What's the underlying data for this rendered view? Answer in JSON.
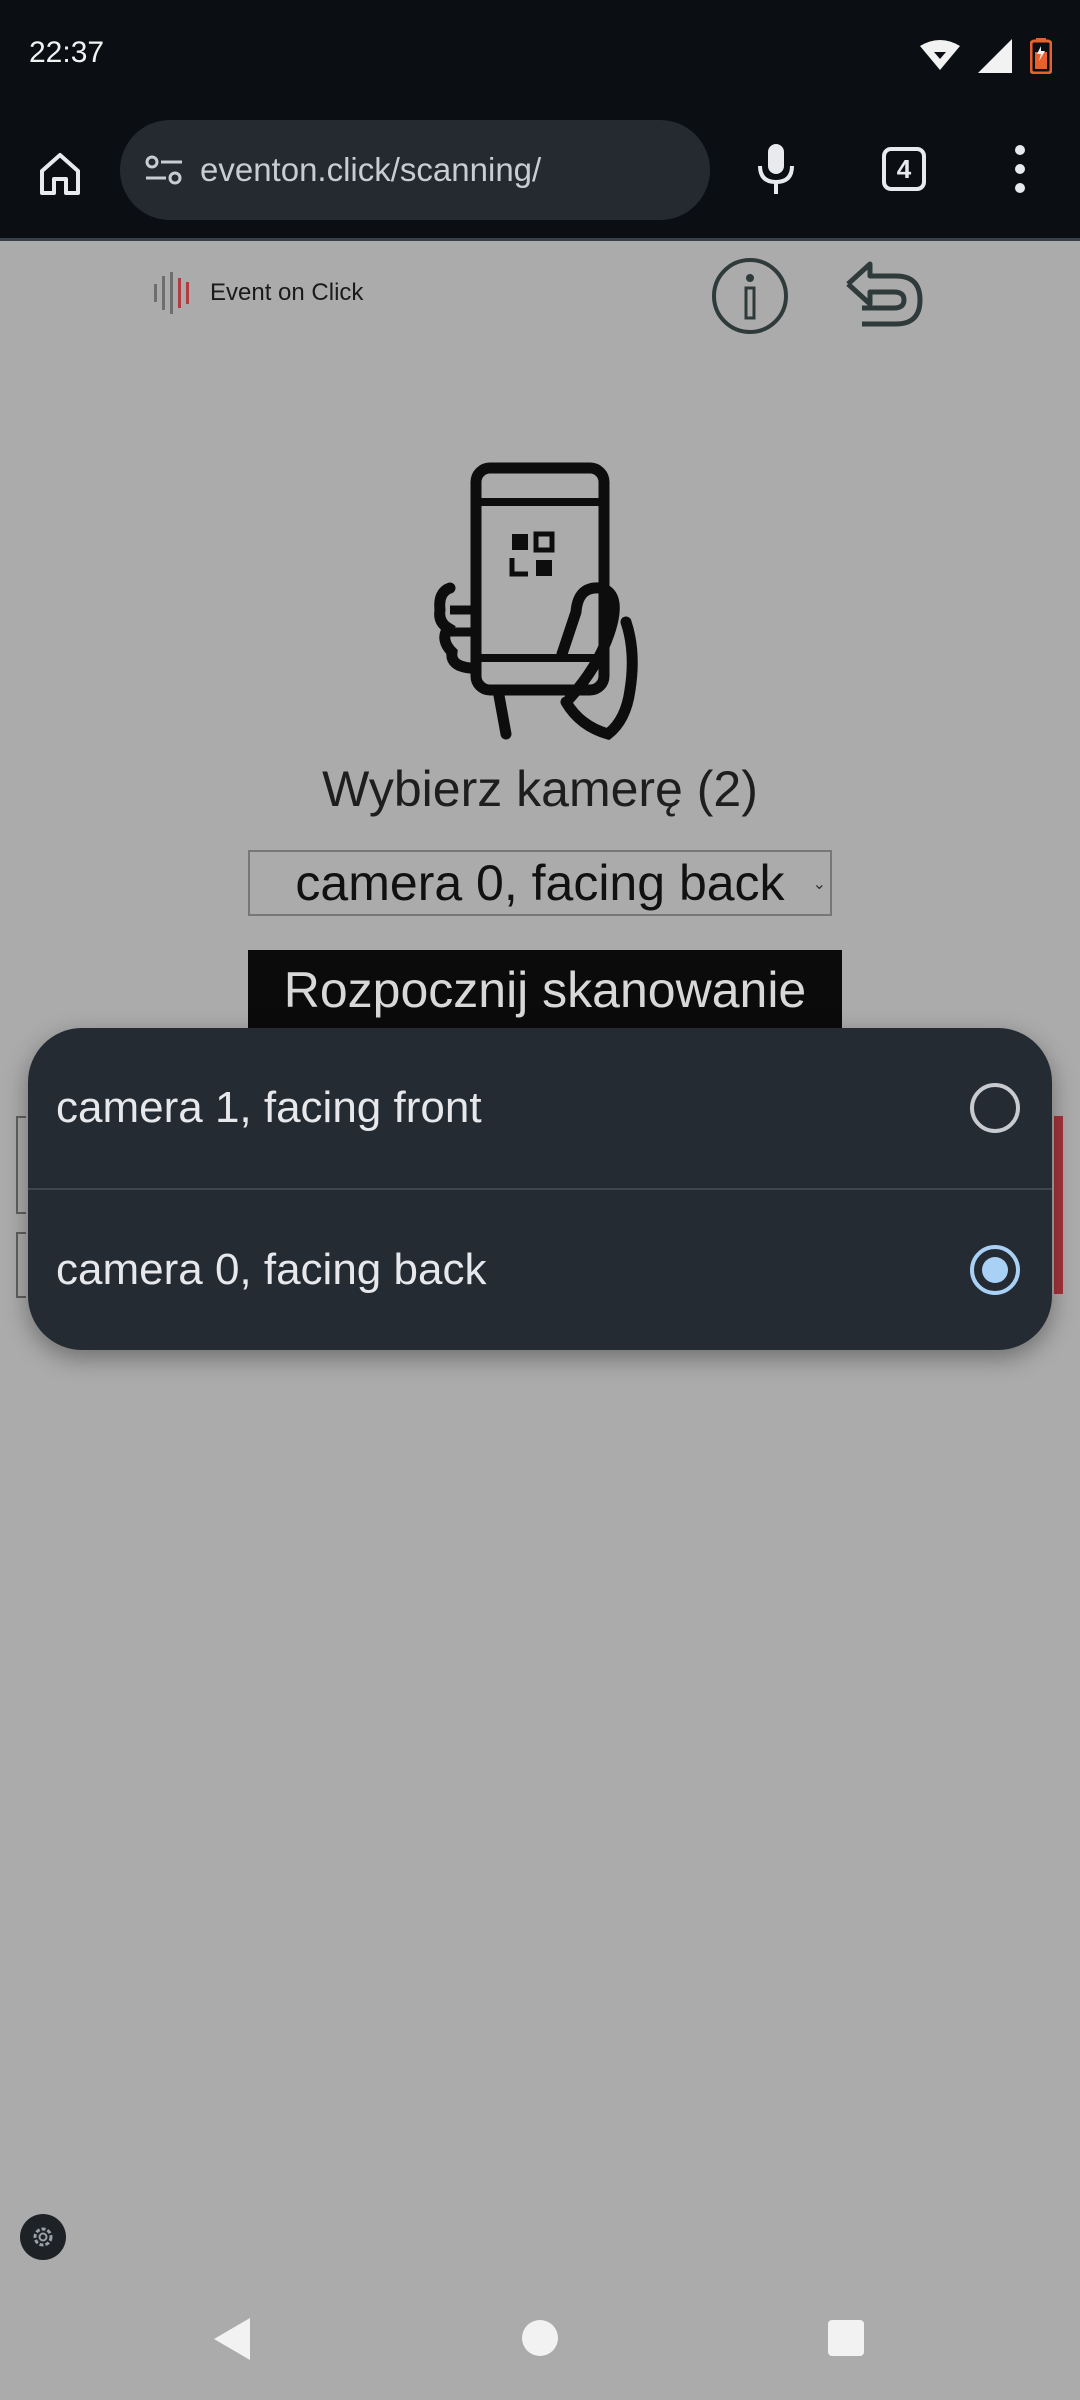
{
  "status_bar": {
    "time": "22:37",
    "icons": [
      "wifi-icon",
      "signal-icon",
      "battery-charging-icon"
    ],
    "battery_color": "#e8612c"
  },
  "browser": {
    "url": "eventon.click/scanning/",
    "tab_count": "4",
    "icons": [
      "home-icon",
      "site-settings-icon",
      "mic-icon",
      "tabs-icon",
      "more-vert-icon"
    ]
  },
  "page": {
    "logo_text": "Event on Click",
    "heading": "Wybierz kamerę (2)",
    "camera_select_value": "camera 0, facing back",
    "start_button": "Rozpocznij skanowanie",
    "icons": [
      "info-icon",
      "undo-icon",
      "phone-qr-scan-icon",
      "settings-icon"
    ]
  },
  "camera_dialog": {
    "options": [
      {
        "label": "camera 1, facing front",
        "selected": false
      },
      {
        "label": "camera 0, facing back",
        "selected": true
      }
    ],
    "accent": "#a8d1f5",
    "background": "#252b33"
  },
  "nav_bar": {
    "icons": [
      "nav-back-icon",
      "nav-home-icon",
      "nav-recents-icon"
    ]
  }
}
